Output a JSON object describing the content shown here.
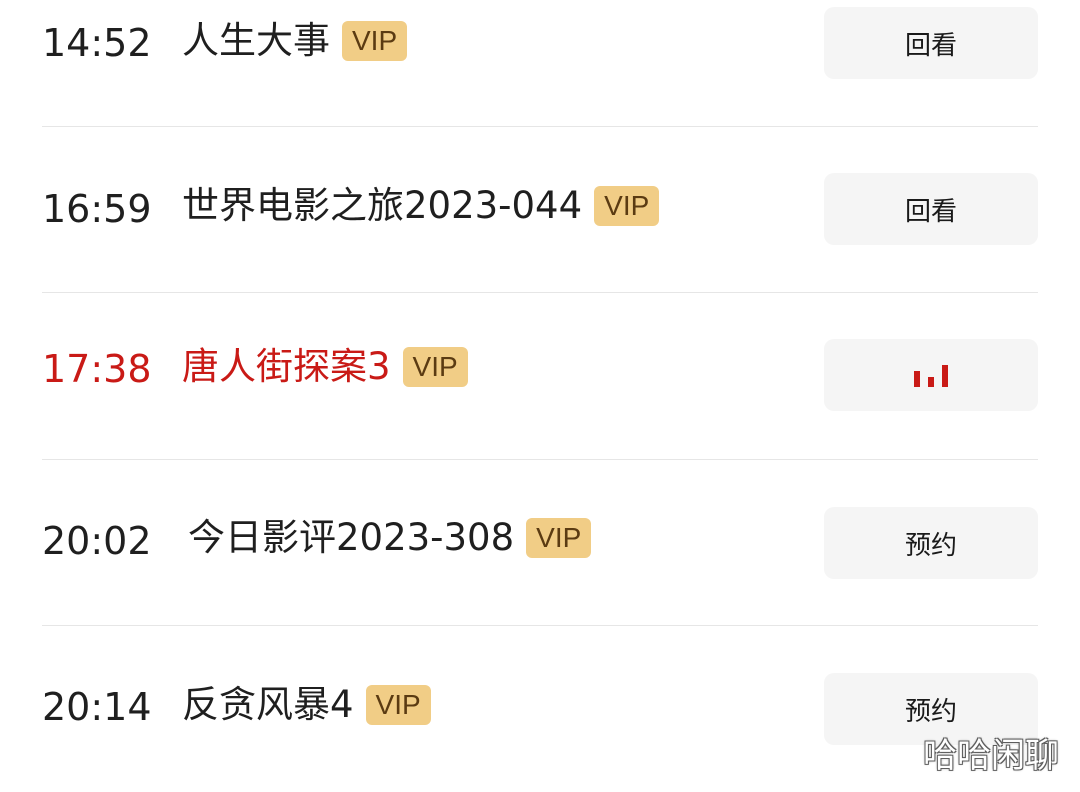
{
  "schedule": {
    "items": [
      {
        "time": "14:52",
        "title": "人生大事",
        "badge": "VIP",
        "action": "回看",
        "state": "replay"
      },
      {
        "time": "16:59",
        "title": "世界电影之旅2023-044",
        "badge": "VIP",
        "action": "回看",
        "state": "replay"
      },
      {
        "time": "17:38",
        "title": "唐人街探案3",
        "badge": "VIP",
        "action": "",
        "state": "live"
      },
      {
        "time": "20:02",
        "title": "今日影评2023-308",
        "badge": "VIP",
        "action": "预约",
        "state": "reserve"
      },
      {
        "time": "20:14",
        "title": "反贪风暴4",
        "badge": "VIP",
        "action": "预约",
        "state": "reserve"
      }
    ]
  },
  "icons": {
    "live": "playing-bars-icon"
  },
  "colors": {
    "live_accent": "#c91a16",
    "vip_badge_bg": "#f1cd86",
    "button_bg": "#f5f5f5"
  },
  "watermark": "哈哈闲聊"
}
